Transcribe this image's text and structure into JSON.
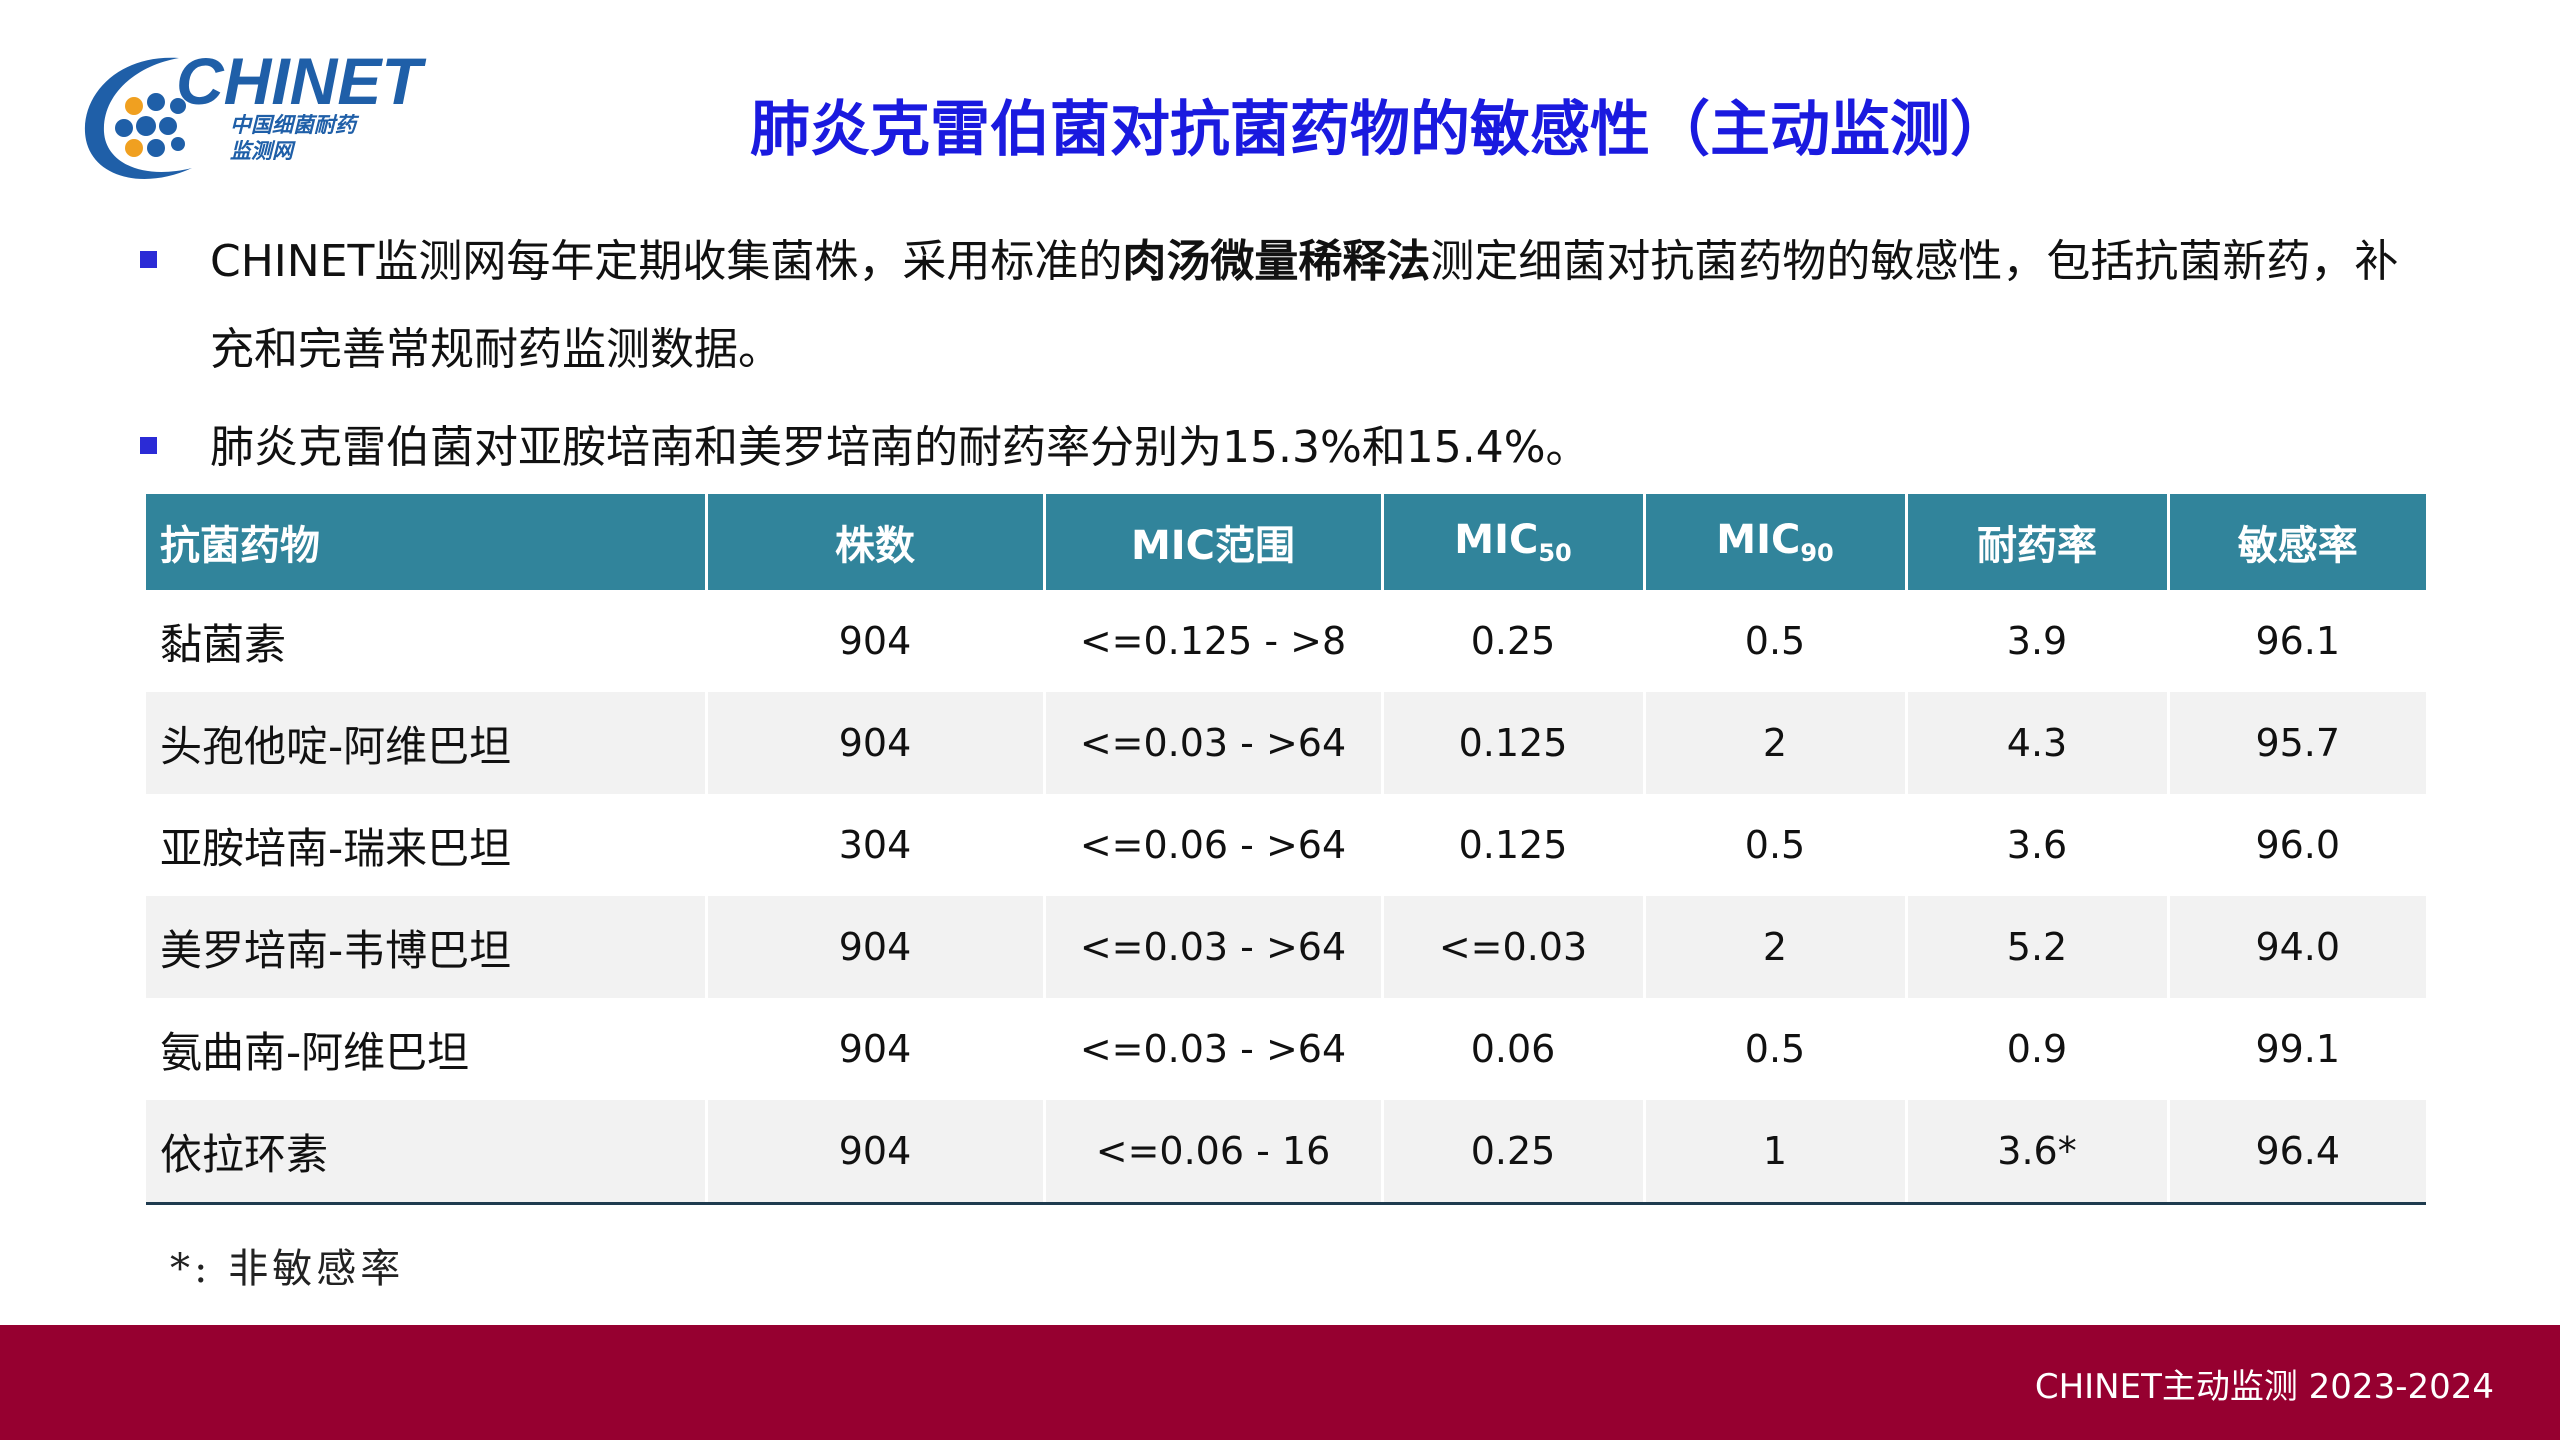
{
  "logo": {
    "wordmark": "CHINET",
    "subtitle_line1": "中国细菌耐药",
    "subtitle_line2": "监测网"
  },
  "title": "肺炎克雷伯菌对抗菌药物的敏感性（主动监测）",
  "bullets": [
    {
      "pre": "CHINET监测网每年定期收集菌株，采用标准的",
      "bold": "肉汤微量稀释法",
      "post": "测定细菌对抗菌药物的敏感性，包括抗菌新药，补充和完善常规耐药监测数据。"
    },
    {
      "text": "肺炎克雷伯菌对亚胺培南和美罗培南的耐药率分别为15.3%和15.4%。"
    }
  ],
  "table": {
    "headers": {
      "drug": "抗菌药物",
      "count": "株数",
      "mic_range": "MIC范围",
      "mic50_base": "MIC",
      "mic50_sub": "50",
      "mic90_base": "MIC",
      "mic90_sub": "90",
      "resistance": "耐药率",
      "susceptibility": "敏感率"
    },
    "rows": [
      [
        "黏菌素",
        "904",
        "<=0.125 - >8",
        "0.25",
        "0.5",
        "3.9",
        "96.1"
      ],
      [
        "头孢他啶-阿维巴坦",
        "904",
        "<=0.03 - >64",
        "0.125",
        "2",
        "4.3",
        "95.7"
      ],
      [
        "亚胺培南-瑞来巴坦",
        "304",
        "<=0.06 - >64",
        "0.125",
        "0.5",
        "3.6",
        "96.0"
      ],
      [
        "美罗培南-韦博巴坦",
        "904",
        "<=0.03 - >64",
        "<=0.03",
        "2",
        "5.2",
        "94.0"
      ],
      [
        "氨曲南-阿维巴坦",
        "904",
        "<=0.03 - >64",
        "0.06",
        "0.5",
        "0.9",
        "99.1"
      ],
      [
        "依拉环素",
        "904",
        "<=0.06 - 16",
        "0.25",
        "1",
        "3.6*",
        "96.4"
      ]
    ]
  },
  "footnote": "*: 非敏感率",
  "footer": "CHINET主动监测 2023-2024",
  "colors": {
    "title": "#1a1adf",
    "header_bg": "#31849b",
    "footer_bg": "#960030",
    "bullet": "#2b2bd6",
    "logo_blue": "#1f5fa8",
    "logo_orange": "#f0a020"
  }
}
